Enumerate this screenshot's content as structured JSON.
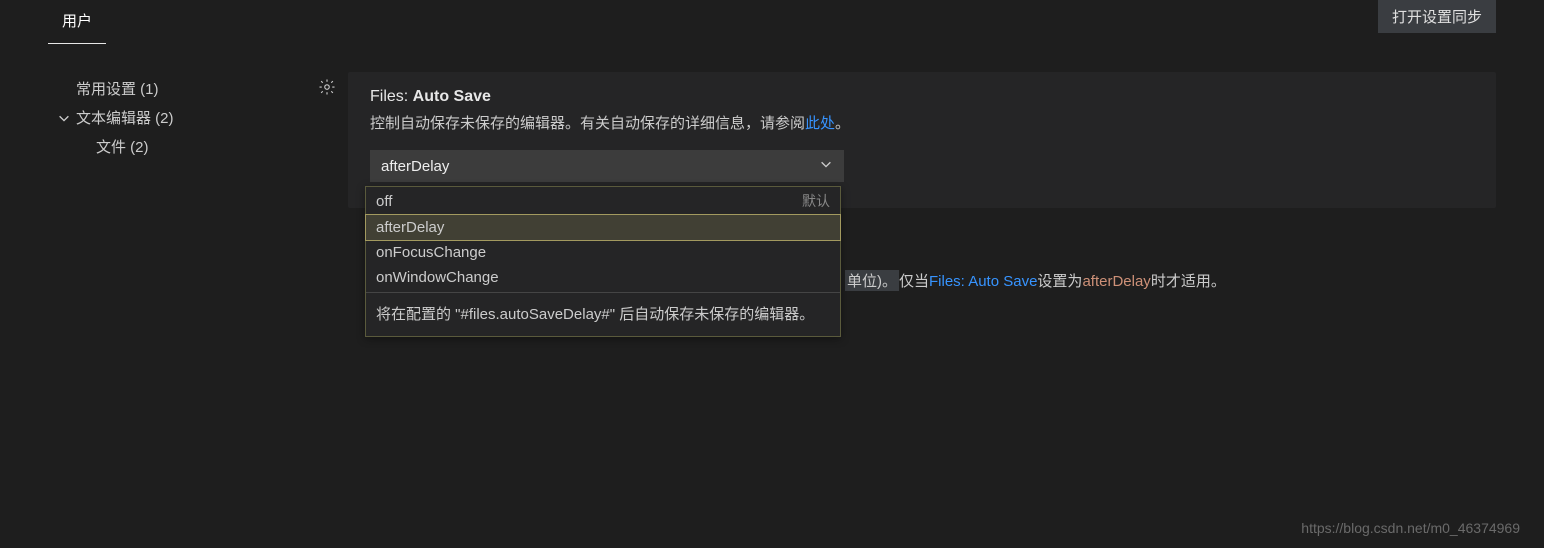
{
  "tabs": {
    "user": "用户"
  },
  "syncButton": "打开设置同步",
  "sidebar": {
    "items": [
      {
        "label": "常用设置 (1)"
      },
      {
        "label": "文本编辑器 (2)"
      },
      {
        "label": "文件 (2)"
      }
    ]
  },
  "setting": {
    "prefix": "Files: ",
    "name": "Auto Save",
    "desc1": "控制自动保存未保存的编辑器。有关自动保存的详细信息，请参阅",
    "link": "此处",
    "desc2": "。",
    "selected": "afterDelay"
  },
  "dropdown": {
    "options": [
      {
        "label": "off",
        "default": "默认"
      },
      {
        "label": "afterDelay"
      },
      {
        "label": "onFocusChange"
      },
      {
        "label": "onWindowChange"
      }
    ],
    "footer": "将在配置的 \"#files.autoSaveDelay#\" 后自动保存未保存的编辑器。"
  },
  "below": {
    "p1": "单位)。",
    "p2": "仅当 ",
    "link": "Files: Auto Save",
    "p3": " 设置为",
    "code": "afterDelay",
    "p4": "时才适用。"
  },
  "watermark": "https://blog.csdn.net/m0_46374969"
}
